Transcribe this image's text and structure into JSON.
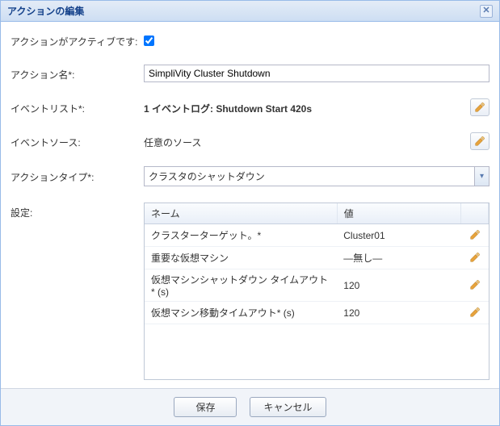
{
  "dialog": {
    "title": "アクションの編集"
  },
  "form": {
    "active_label": "アクションがアクティブです:",
    "active_checked": true,
    "name_label": "アクション名*:",
    "name_value": "SimpliVity Cluster Shutdown",
    "eventlist_label": "イベントリスト*:",
    "eventlist_text": "1 イベントログ: Shutdown Start 420s",
    "eventsource_label": "イベントソース:",
    "eventsource_text": "任意のソース",
    "actiontype_label": "アクションタイプ*:",
    "actiontype_value": "クラスタのシャットダウン",
    "settings_label": "設定:"
  },
  "grid": {
    "headers": {
      "name": "ネーム",
      "value": "値"
    },
    "rows": [
      {
        "name": "クラスターターゲット。*",
        "value": "Cluster01"
      },
      {
        "name": "重要な仮想マシン",
        "value": "―無し―"
      },
      {
        "name": "仮想マシンシャットダウン タイムアウト* (s)",
        "value": "120"
      },
      {
        "name": "仮想マシン移動タイムアウト* (s)",
        "value": "120"
      }
    ]
  },
  "buttons": {
    "save": "保存",
    "cancel": "キャンセル"
  }
}
